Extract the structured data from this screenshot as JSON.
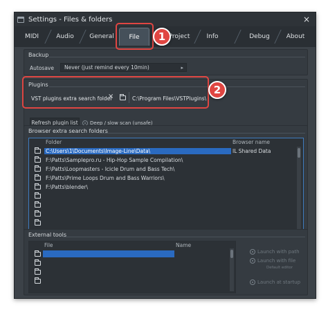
{
  "window": {
    "title": "Settings - Files & folders",
    "close": "×"
  },
  "tabs": [
    {
      "label": "MIDI"
    },
    {
      "label": "Audio"
    },
    {
      "label": "General"
    },
    {
      "label": "File"
    },
    {
      "label": "Project"
    },
    {
      "label": "Info"
    },
    {
      "label": "Debug"
    },
    {
      "label": "About"
    }
  ],
  "backup": {
    "title": "Backup",
    "autosave_label": "Autosave",
    "autosave_value": "Never (just remind every 10min)",
    "arrow": "▸"
  },
  "plugins": {
    "title": "Plugins",
    "vst_label": "VST plugins extra search folder",
    "clear": "×",
    "path": "C:\\Program Files\\VSTPlugins\\",
    "refresh_button": "Refresh plugin list",
    "scan_option": "Deep / slow scan (unsafe)"
  },
  "browser_folders": {
    "title": "Browser extra search folders",
    "columns": [
      "Folder",
      "Browser name"
    ],
    "rows": [
      {
        "path": "C:\\Users\\1\\Documents\\Image-Line\\Data\\",
        "name": "IL Shared Data"
      },
      {
        "path": "F:\\Patts\\Samplepro.ru - Hip-Hop Sample Compilation\\",
        "name": ""
      },
      {
        "path": "F:\\Patts\\Loopmasters - Icicle Drum and Bass Tech\\",
        "name": ""
      },
      {
        "path": "F:\\Patts\\Prime Loops Drum and Bass Warriors\\",
        "name": ""
      },
      {
        "path": "F:\\Patts\\blender\\",
        "name": ""
      },
      {
        "path": "",
        "name": ""
      },
      {
        "path": "",
        "name": ""
      },
      {
        "path": "",
        "name": ""
      },
      {
        "path": "",
        "name": ""
      }
    ]
  },
  "external_tools": {
    "title": "External tools",
    "columns": [
      "File",
      "Name"
    ],
    "options": {
      "launch_with_path": "Launch with path",
      "launch_with_file": "Launch with file",
      "default_editor": "Default editor",
      "launch_at_startup": "Launch at startup"
    }
  },
  "callouts": {
    "one": "1",
    "two": "2"
  },
  "colors": {
    "accent": "#2a6ac0",
    "callout": "#e04642",
    "panel": "#353b41"
  }
}
